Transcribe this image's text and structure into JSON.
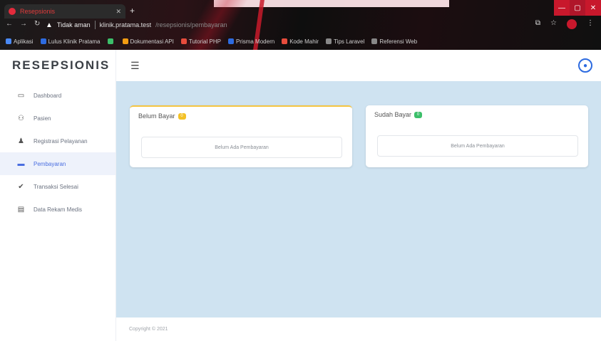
{
  "browser": {
    "tab_title": "Resepsionis",
    "address": {
      "security": "Tidak aman",
      "url_host": "klinik.pratama.test",
      "url_path": "/resepsionis/pembayaran"
    },
    "bookmarks": [
      {
        "label": "Aplikasi",
        "color": "#4a8af4"
      },
      {
        "label": "Lulus Klinik Pratama",
        "color": "#2d6be0"
      },
      {
        "label": "",
        "color": "#3cbf6a"
      },
      {
        "label": "Dokumentasi API",
        "color": "#f39c12"
      },
      {
        "label": "Tutorial PHP",
        "color": "#e74c3c"
      },
      {
        "label": "Prisma Modern",
        "color": "#2d6be0"
      },
      {
        "label": "Kode Mahir",
        "color": "#e74c3c"
      },
      {
        "label": "Tips Laravel",
        "color": "#888888"
      },
      {
        "label": "Referensi Web",
        "color": "#888888"
      }
    ]
  },
  "sidebar": {
    "brand": "RESEPSIONIS",
    "items": [
      {
        "label": "Dashboard",
        "icon": "monitor-icon",
        "active": false
      },
      {
        "label": "Pasien",
        "icon": "users-icon",
        "active": false
      },
      {
        "label": "Registrasi Pelayanan",
        "icon": "user-plus-icon",
        "active": false
      },
      {
        "label": "Pembayaran",
        "icon": "money-icon",
        "active": true
      },
      {
        "label": "Transaksi Selesai",
        "icon": "check-icon",
        "active": false
      },
      {
        "label": "Data Rekam Medis",
        "icon": "file-icon",
        "active": false
      }
    ]
  },
  "main": {
    "cards": [
      {
        "title": "Belum Bayar",
        "badge": "0",
        "badge_color": "#f3c126",
        "empty_text": "Belum Ada Pembayaran"
      },
      {
        "title": "Sudah Bayar",
        "badge": "0",
        "badge_color": "#3cbf6a",
        "empty_text": "Belum Ada Pembayaran"
      }
    ]
  },
  "footer": {
    "text": "Copyright © 2021"
  }
}
